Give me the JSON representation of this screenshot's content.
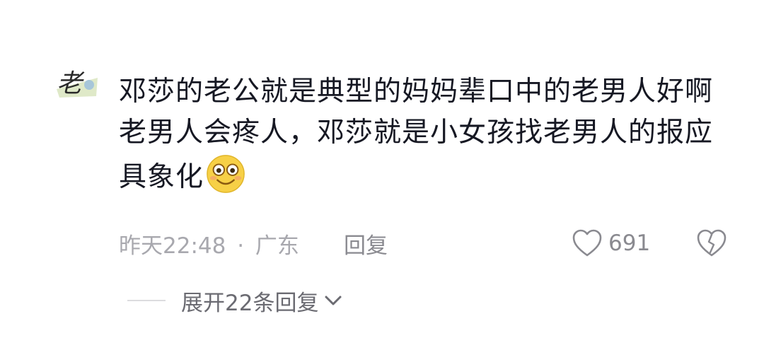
{
  "comment": {
    "avatar_text": "老",
    "lines": [
      "邓莎的老公就是典型的妈妈辈口中的老男人好啊",
      "老男人会疼人，邓莎就是小女孩找老男人的报应",
      "具象化"
    ],
    "emoji": "smiling-face-emoji",
    "time": "昨天22:48",
    "separator": "·",
    "location": "广东",
    "reply_label": "回复",
    "like_count": "691",
    "expand_label": "展开22条回复"
  },
  "icons": {
    "like": "heart-icon",
    "dislike": "broken-heart-icon",
    "expand": "chevron-down-icon"
  },
  "colors": {
    "text_primary": "#161823",
    "text_meta": "#a8a8ae",
    "emoji_fill": "#f7d046"
  }
}
